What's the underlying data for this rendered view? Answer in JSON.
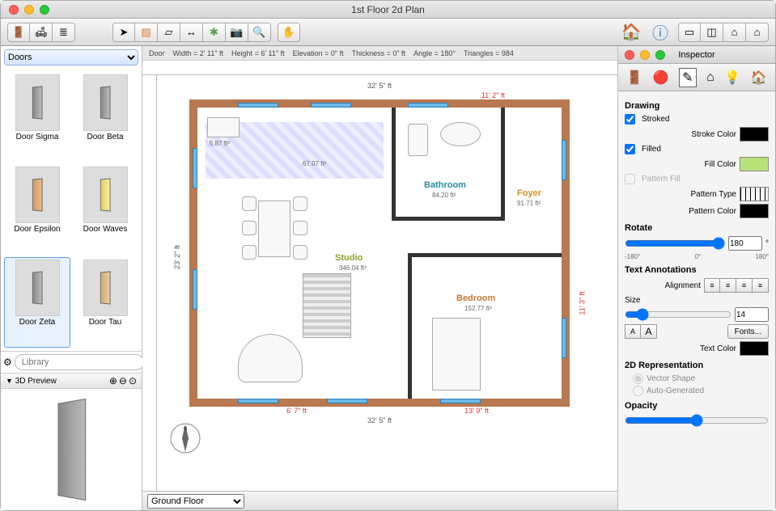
{
  "window_title": "1st Floor 2d Plan",
  "info": {
    "object": "Door",
    "width": "2' 11\" ft",
    "height": "6' 11\" ft",
    "elevation": "0\" ft",
    "thickness": "0\" ft",
    "angle": "180°",
    "triangles": "984"
  },
  "library": {
    "category": "Doors",
    "search_placeholder": "Library",
    "preview_label": "3D Preview",
    "items": [
      {
        "name": "Door Sigma"
      },
      {
        "name": "Door Beta"
      },
      {
        "name": "Door Epsilon"
      },
      {
        "name": "Door Waves"
      },
      {
        "name": "Door Zeta",
        "selected": true
      },
      {
        "name": "Door Tau"
      }
    ]
  },
  "floor": {
    "selected": "Ground Floor"
  },
  "plan": {
    "width_top": "32' 5\" ft",
    "width_bottom": "32' 5\" ft",
    "height_left": "23' 2\" ft",
    "height_right": "11' 3\" ft",
    "hall_width": "11' 2\" ft",
    "seg_a": "6' 7\" ft",
    "seg_b": "13' 9\" ft",
    "closet": "5.87 ft²",
    "kitchen_area": "67.07 ft²",
    "rooms": {
      "bathroom": {
        "label": "Bathroom",
        "area": "84.20 ft²"
      },
      "foyer": {
        "label": "Foyer",
        "area": "91.71 ft²"
      },
      "studio": {
        "label": "Studio",
        "area": "346.04 ft²"
      },
      "bedroom": {
        "label": "Bedroom",
        "area": "152.77 ft²"
      }
    }
  },
  "inspector": {
    "title": "Inspector",
    "drawing": "Drawing",
    "stroked": "Stroked",
    "stroke_color_label": "Stroke Color",
    "filled": "Filled",
    "fill_color_label": "Fill Color",
    "pattern_fill": "Pattern Fill",
    "pattern_type": "Pattern Type",
    "pattern_color": "Pattern Color",
    "rotate": "Rotate",
    "rotate_value": "180",
    "rotate_min": "-180°",
    "rotate_mid": "0°",
    "rotate_max": "180°",
    "text_annotations": "Text Annotations",
    "alignment": "Alignment",
    "size": "Size",
    "size_value": "14",
    "fonts": "Fonts...",
    "text_color": "Text Color",
    "rep2d": "2D Representation",
    "vector": "Vector Shape",
    "auto": "Auto-Generated",
    "opacity": "Opacity",
    "colors": {
      "stroke": "#000000",
      "fill": "#b8e27a",
      "pattern": "#000000",
      "text": "#000000"
    }
  }
}
